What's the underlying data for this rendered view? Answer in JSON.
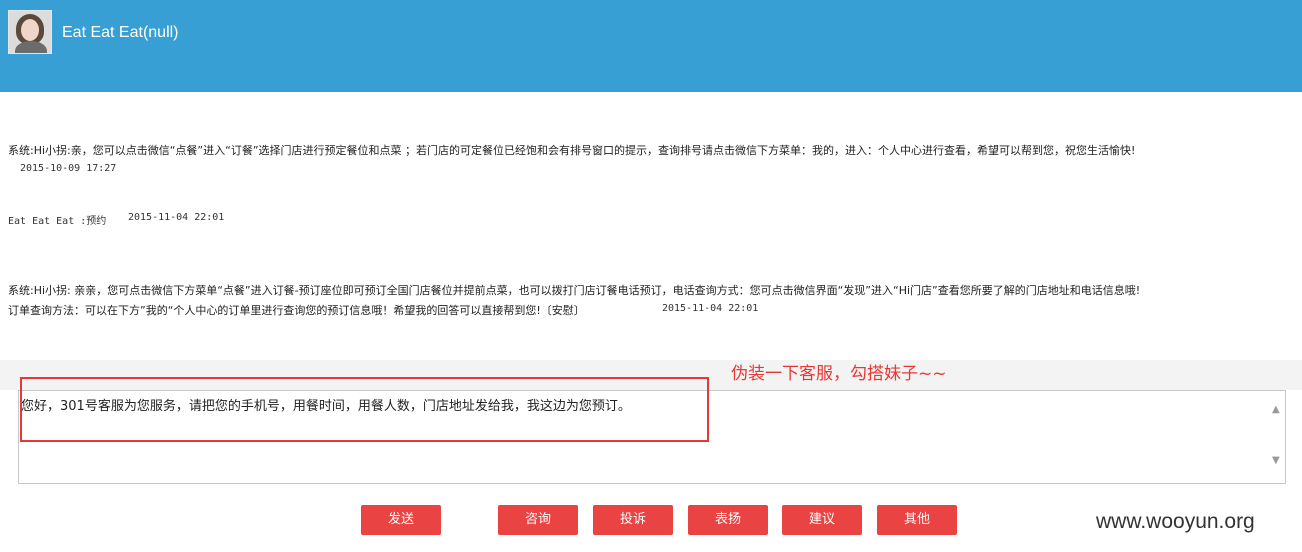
{
  "header": {
    "title": "Eat Eat Eat(null)"
  },
  "messages": [
    {
      "text": "系统:Hi小拐:亲，您可以点击微信“点餐”进入“订餐”选择门店进行预定餐位和点菜 ；若门店的可定餐位已经饱和会有排号窗口的提示，查询排号请点击微信下方菜单：我的，进入：个人中心进行查看，希望可以帮到您，祝您生活愉快!",
      "time": "2015-10-09 17:27"
    },
    {
      "text": "Eat Eat Eat :预约",
      "time": "2015-11-04 22:01"
    },
    {
      "text_line1": "系统:Hi小拐: 亲亲，您可点击微信下方菜单“点餐”进入订餐-预订座位即可预订全国门店餐位并提前点菜，也可以拨打门店订餐电话预订，电话查询方式：您可点击微信界面“发现”进入“Hi门店”查看您所要了解的门店地址和电话信息哦!",
      "text_line2": "订单查询方法：可以在下方”我的“个人中心的订单里进行查询您的预订信息哦！希望我的回答可以直接帮到您!〔安慰〕",
      "time": "2015-11-04 22:01"
    }
  ],
  "annotation_note": "伪装一下客服，勾搭妹子~~",
  "input": {
    "value": "您好，301号客服为您服务，请把您的手机号，用餐时间，用餐人数，门店地址发给我，我这边为您预订。"
  },
  "buttons": {
    "send": "发送",
    "consult": "咨询",
    "complain": "投诉",
    "praise": "表扬",
    "suggest": "建议",
    "other": "其他"
  },
  "watermark": "www.wooyun.org",
  "colors": {
    "header": "#379fd4",
    "button": "#e94343",
    "annotation": "#e53935"
  }
}
